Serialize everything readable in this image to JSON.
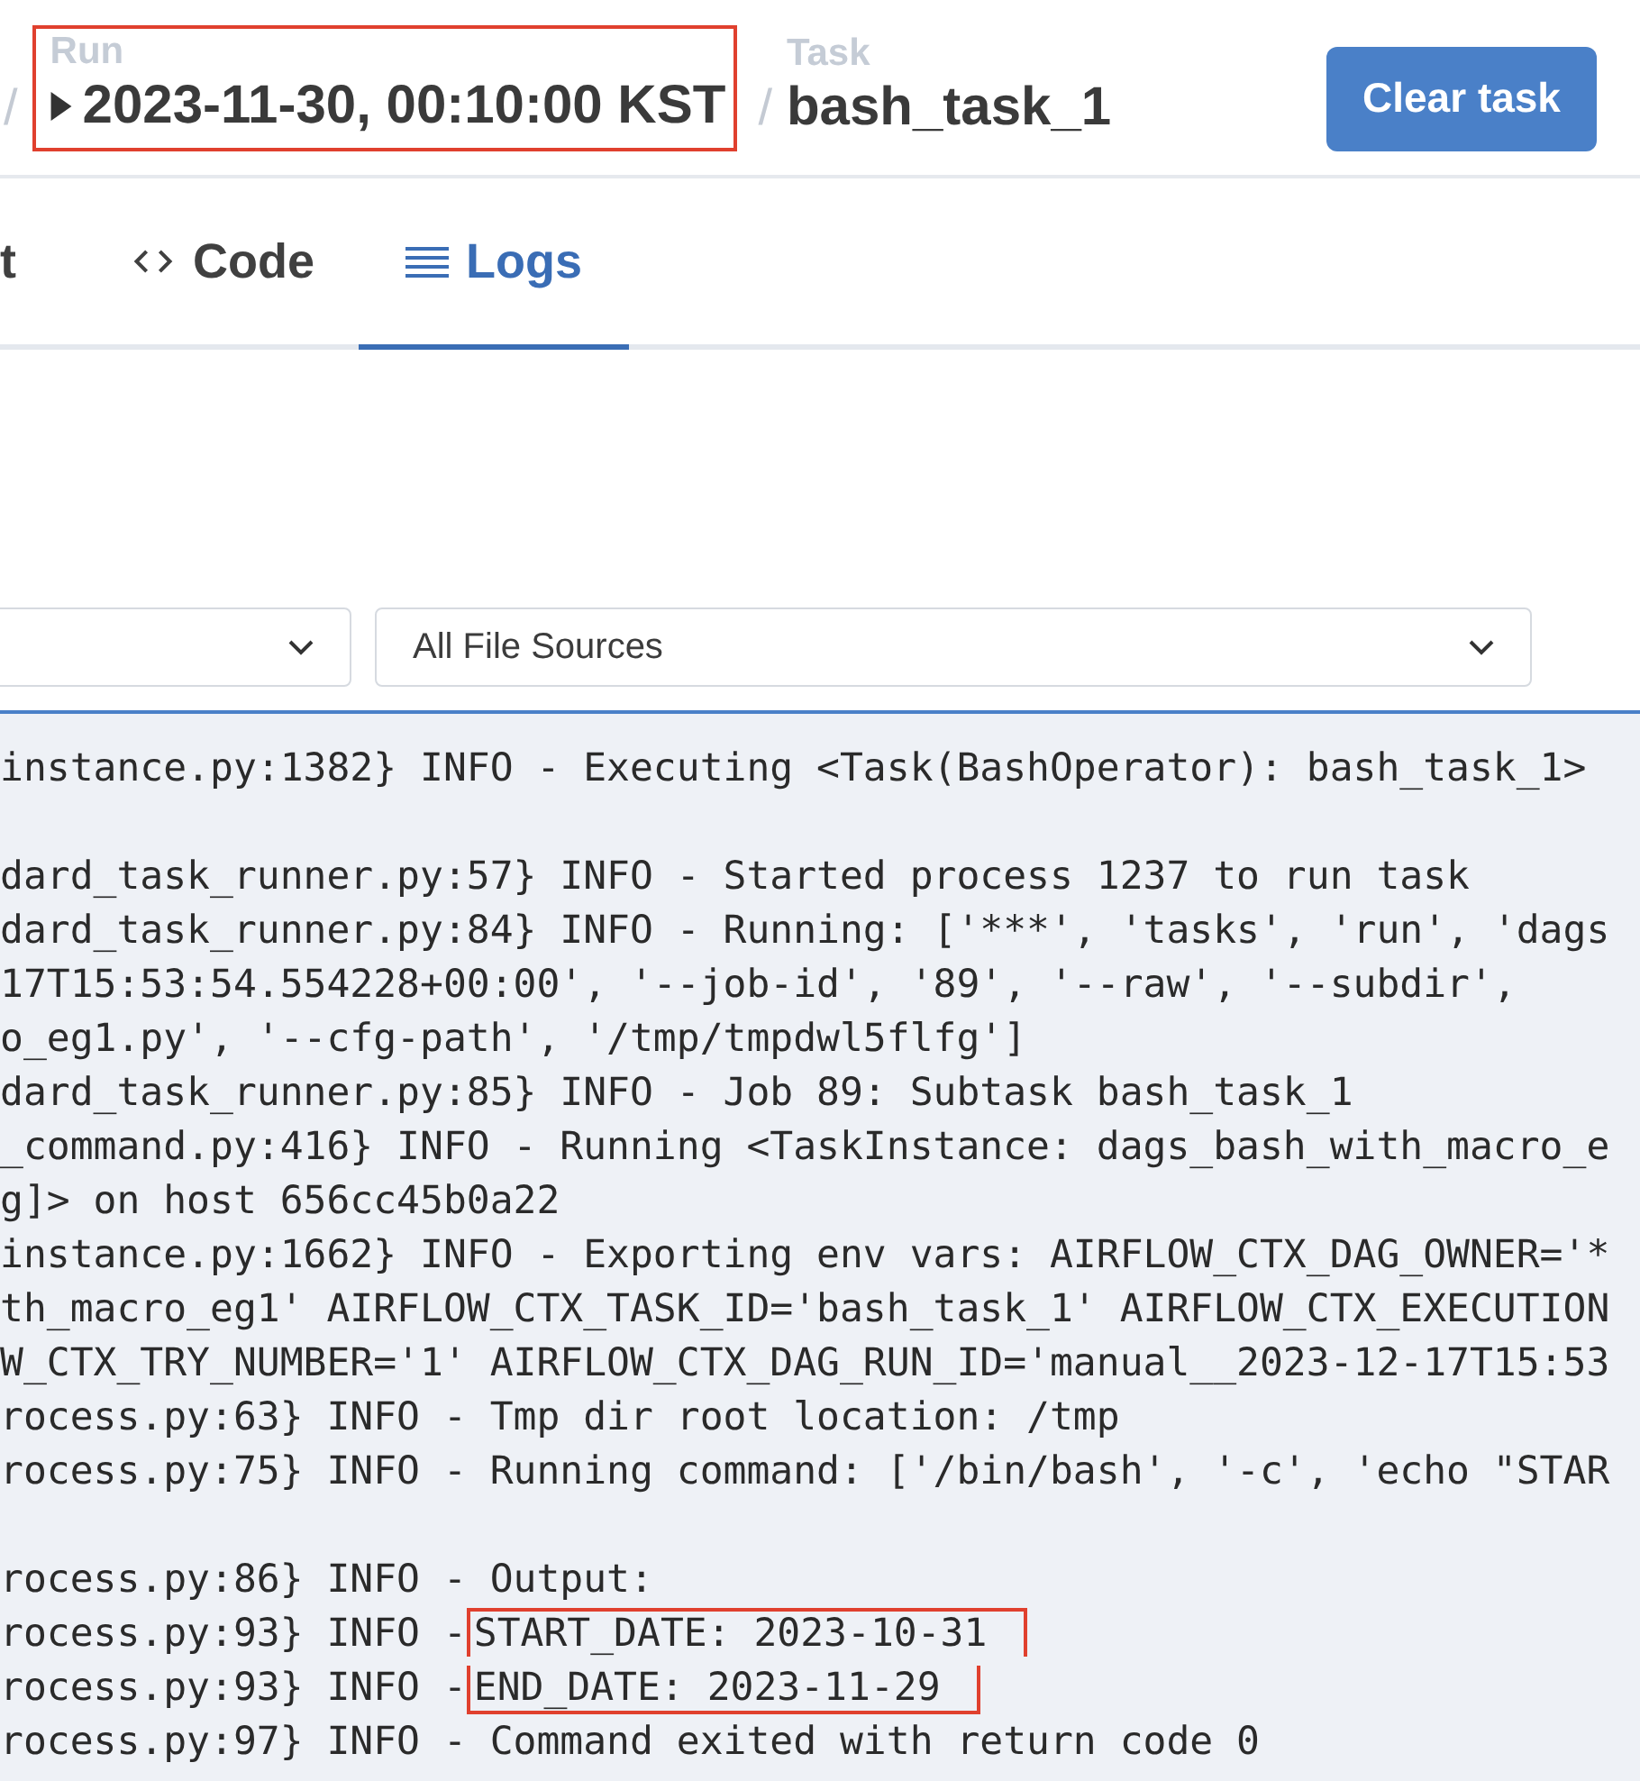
{
  "breadcrumb": {
    "run": {
      "label": "Run",
      "value": "2023-11-30, 00:10:00 KST",
      "annotated": true
    },
    "task": {
      "label": "Task",
      "value": "bash_task_1"
    },
    "separator": "/"
  },
  "clear_button": "Clear task",
  "tabs": [
    {
      "label": "t",
      "selected": false
    },
    {
      "label": "Code",
      "selected": false
    },
    {
      "label": "Logs",
      "selected": true
    }
  ],
  "filters": [
    {
      "kind": "blank"
    },
    {
      "kind": "value",
      "value": "All File Sources"
    }
  ],
  "log_lines": [
    {
      "kind": "text",
      "text": "instance.py:1382} INFO - Executing <Task(BashOperator): bash_task_1>"
    },
    {
      "kind": "blank"
    },
    {
      "kind": "text",
      "text": "dard_task_runner.py:57} INFO - Started process 1237 to run task"
    },
    {
      "kind": "text",
      "text": "dard_task_runner.py:84} INFO - Running: ['***', 'tasks', 'run', 'dags"
    },
    {
      "kind": "text",
      "text": "17T15:53:54.554228+00:00', '--job-id', '89', '--raw', '--subdir',"
    },
    {
      "kind": "text",
      "text": "o_eg1.py', '--cfg-path', '/tmp/tmpdwl5flfg']"
    },
    {
      "kind": "text",
      "text": "dard_task_runner.py:85} INFO - Job 89: Subtask bash_task_1"
    },
    {
      "kind": "text",
      "text": "_command.py:416} INFO - Running <TaskInstance: dags_bash_with_macro_e"
    },
    {
      "kind": "text",
      "text": "g]> on host 656cc45b0a22"
    },
    {
      "kind": "text",
      "text": "instance.py:1662} INFO - Exporting env vars: AIRFLOW_CTX_DAG_OWNER='*"
    },
    {
      "kind": "text",
      "text": "th_macro_eg1' AIRFLOW_CTX_TASK_ID='bash_task_1' AIRFLOW_CTX_EXECUTION"
    },
    {
      "kind": "text",
      "text": "W_CTX_TRY_NUMBER='1' AIRFLOW_CTX_DAG_RUN_ID='manual__2023-12-17T15:53"
    },
    {
      "kind": "text",
      "text": "rocess.py:63} INFO - Tmp dir root location: /tmp"
    },
    {
      "kind": "text",
      "text": "rocess.py:75} INFO - Running command: ['/bin/bash', '-c', 'echo \"STAR"
    },
    {
      "kind": "blank"
    },
    {
      "kind": "text",
      "text": "rocess.py:86} INFO - Output:"
    },
    {
      "kind": "marked",
      "text": "rocess.py:93} INFO -",
      "marked_text": "START_DATE: 2023-10-31"
    },
    {
      "kind": "marked",
      "text": "rocess.py:93} INFO -",
      "marked_text": "END_DATE: 2023-11-29"
    },
    {
      "kind": "text",
      "text": "rocess.py:97} INFO - Command exited with return code 0"
    }
  ]
}
